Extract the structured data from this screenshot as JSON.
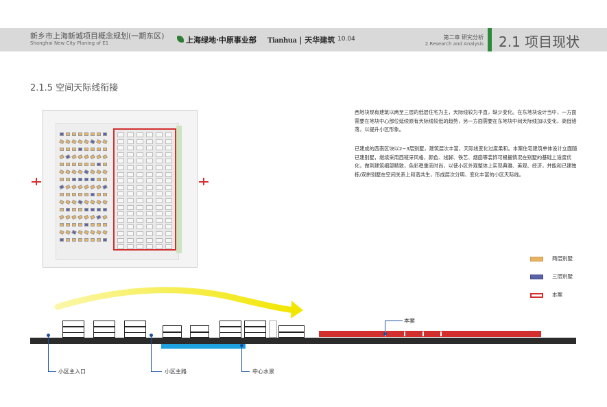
{
  "header": {
    "project_title": "新乡市上海新城项目概念规划(一期东区)",
    "project_subtitle": "Shanghai New City Planing of E1",
    "logo1": "上海绿地·中原事业部",
    "logo2_en": "Tianhua",
    "logo2_cn": "天华建筑",
    "version": "10.04",
    "chapter": "第二章 研究分析",
    "chapter_en": "2.Research and Analysis",
    "section": "2.1 项目现状"
  },
  "section_title": "2.1.5 空间天际线衔接",
  "paragraphs": [
    "西地块现有建筑以两至三层的低层住宅为主，天际线较为平直，缺少变化。在东地块设计当中，一方面需要在地块中心部位延续原有天际线较低的趋势，另一方面需要在东地块中间天际线加以变化，高低错落，以提升小区形象。",
    "已建成的西南区块以2~3层别墅，建筑层次丰富，天际线变化过度柔和。本案住宅建筑单体设计立面随已建别墅，继续采用西班牙风格，颜色、线脚、铁艺、烟囱等装饰可根据情况在别墅的基础上适度优化，做到建筑细部精致，色彩稳重而时尚，以使小区外观整体上实现典雅、美观、经济，并能和已建独栋/双拼别墅在空间关系上和谐共生，形成层次分明、变化丰富的小区天际线。"
  ],
  "legend": [
    {
      "label": "两层别墅",
      "color": "#e8b464"
    },
    {
      "label": "三层别墅",
      "color": "#5b63a8"
    },
    {
      "label": "本案",
      "color": "#d32f2f"
    }
  ],
  "skyline": {
    "label_main_entrance": "小区主入口",
    "label_main_road": "小区主路",
    "label_water": "中心水景",
    "label_project": "本案",
    "arrow_color": "#f2e600",
    "water_color": "#1fa2e0",
    "project_color": "#d32f2f"
  }
}
